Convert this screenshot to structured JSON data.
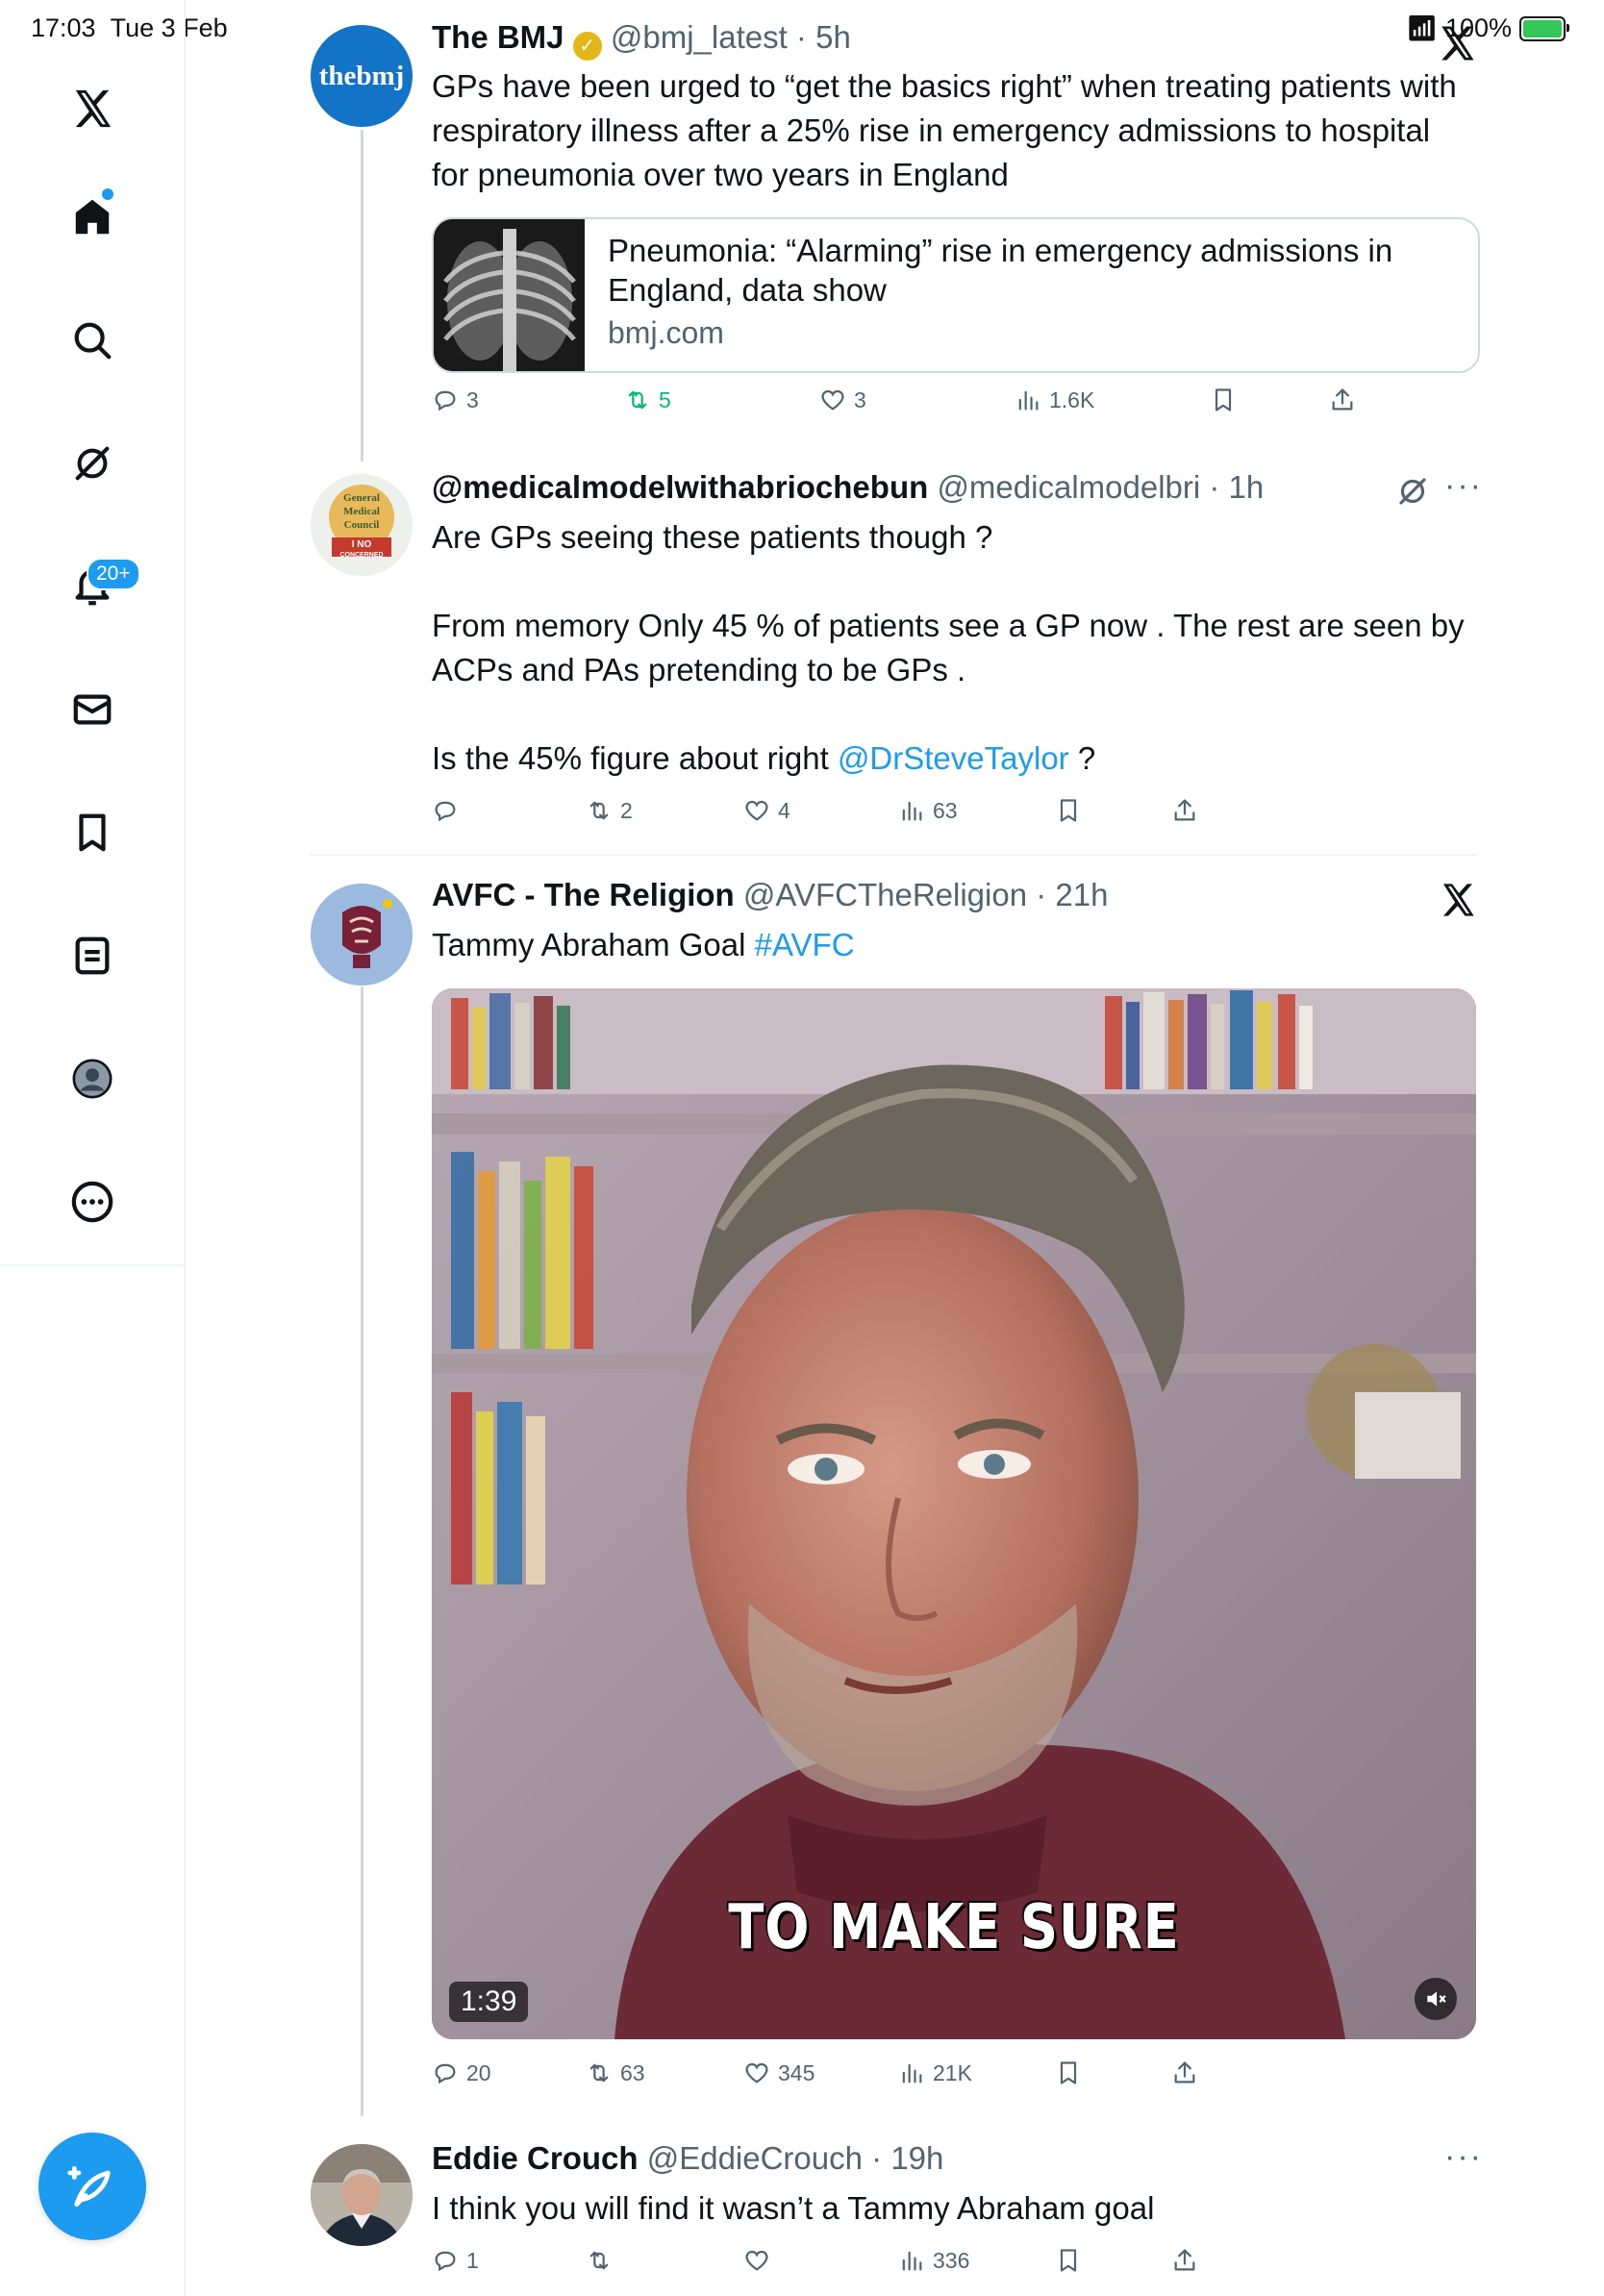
{
  "status": {
    "time": "17:03",
    "date": "Tue 3 Feb",
    "battery": "100%"
  },
  "nav": {
    "items": [
      "x-logo",
      "home",
      "search",
      "grok",
      "notifications",
      "messages",
      "bookmarks",
      "lists",
      "profile",
      "more"
    ],
    "notification_badge": "20+"
  },
  "tweets": [
    {
      "avatar_text": "thebmj",
      "name": "The BMJ",
      "handle": "@bmj_latest",
      "time": "5h",
      "text": "GPs have been urged to “get the basics right” when treating patients with respiratory illness after a 25% rise in emergency admissions to hospital for pneumonia over two years in England",
      "card": {
        "title": "Pneumonia: “Alarming” rise in emergency admissions in England, data show",
        "domain": "bmj.com"
      },
      "replies": "3",
      "reposts": "5",
      "likes": "3",
      "views": "1.6K"
    },
    {
      "name": "@medicalmodelwithabriochebun",
      "handle": "@medicalmodelbri",
      "time": "1h",
      "avatar_text": [
        "General",
        "Medical",
        "Council",
        "I NO",
        "CONCERNED"
      ],
      "text_p1": "Are GPs seeing these patients though ?",
      "text_p2": "From memory Only 45 % of patients see a GP now . The rest are seen by ACPs and PAs pretending to be GPs .",
      "text_p3_before": "Is the 45% figure about right ",
      "text_p3_mention": "@DrSteveTaylor",
      "text_p3_after": " ?",
      "replies": "",
      "reposts": "2",
      "likes": "4",
      "views": "63"
    },
    {
      "name": "AVFC - The Religion",
      "handle": "@AVFCTheReligion",
      "time": "21h",
      "text_before": "Tammy Abraham Goal ",
      "hashtag": "#AVFC",
      "video": {
        "duration": "1:39",
        "caption": "TO MAKE SURE"
      },
      "replies": "20",
      "reposts": "63",
      "likes": "345",
      "views": "21K"
    },
    {
      "name": "Eddie Crouch",
      "handle": "@EddieCrouch",
      "time": "19h",
      "text": "I think you will find it wasn’t a Tammy Abraham goal",
      "replies": "1",
      "reposts": "",
      "likes": "",
      "views": "336"
    }
  ],
  "colors": {
    "accent": "#1d9bf0",
    "text": "#0f1419",
    "muted": "#536471",
    "repost_active": "#00ba7c",
    "bmj_blue": "#1273c7"
  }
}
